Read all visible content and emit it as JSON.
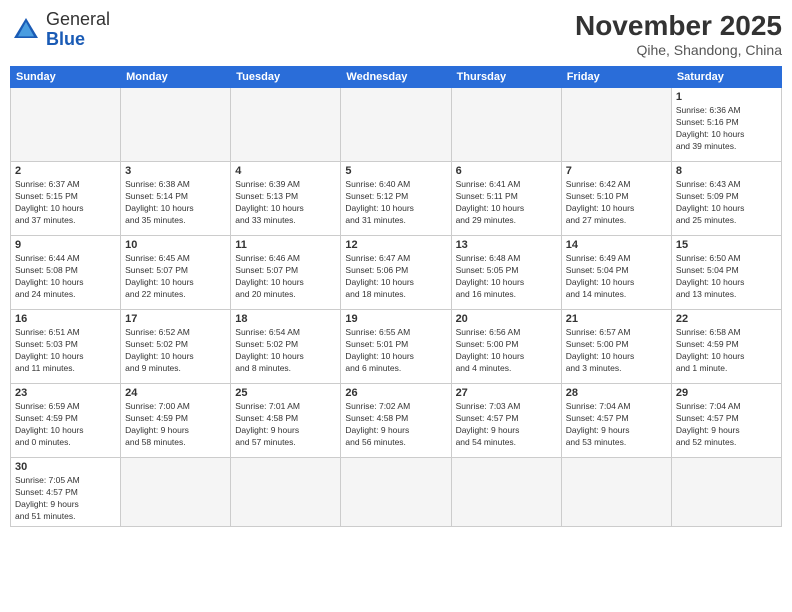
{
  "header": {
    "logo_general": "General",
    "logo_blue": "Blue",
    "month_title": "November 2025",
    "location": "Qihe, Shandong, China"
  },
  "weekdays": [
    "Sunday",
    "Monday",
    "Tuesday",
    "Wednesday",
    "Thursday",
    "Friday",
    "Saturday"
  ],
  "days": {
    "d1": {
      "num": "1",
      "info": "Sunrise: 6:36 AM\nSunset: 5:16 PM\nDaylight: 10 hours\nand 39 minutes."
    },
    "d2": {
      "num": "2",
      "info": "Sunrise: 6:37 AM\nSunset: 5:15 PM\nDaylight: 10 hours\nand 37 minutes."
    },
    "d3": {
      "num": "3",
      "info": "Sunrise: 6:38 AM\nSunset: 5:14 PM\nDaylight: 10 hours\nand 35 minutes."
    },
    "d4": {
      "num": "4",
      "info": "Sunrise: 6:39 AM\nSunset: 5:13 PM\nDaylight: 10 hours\nand 33 minutes."
    },
    "d5": {
      "num": "5",
      "info": "Sunrise: 6:40 AM\nSunset: 5:12 PM\nDaylight: 10 hours\nand 31 minutes."
    },
    "d6": {
      "num": "6",
      "info": "Sunrise: 6:41 AM\nSunset: 5:11 PM\nDaylight: 10 hours\nand 29 minutes."
    },
    "d7": {
      "num": "7",
      "info": "Sunrise: 6:42 AM\nSunset: 5:10 PM\nDaylight: 10 hours\nand 27 minutes."
    },
    "d8": {
      "num": "8",
      "info": "Sunrise: 6:43 AM\nSunset: 5:09 PM\nDaylight: 10 hours\nand 25 minutes."
    },
    "d9": {
      "num": "9",
      "info": "Sunrise: 6:44 AM\nSunset: 5:08 PM\nDaylight: 10 hours\nand 24 minutes."
    },
    "d10": {
      "num": "10",
      "info": "Sunrise: 6:45 AM\nSunset: 5:07 PM\nDaylight: 10 hours\nand 22 minutes."
    },
    "d11": {
      "num": "11",
      "info": "Sunrise: 6:46 AM\nSunset: 5:07 PM\nDaylight: 10 hours\nand 20 minutes."
    },
    "d12": {
      "num": "12",
      "info": "Sunrise: 6:47 AM\nSunset: 5:06 PM\nDaylight: 10 hours\nand 18 minutes."
    },
    "d13": {
      "num": "13",
      "info": "Sunrise: 6:48 AM\nSunset: 5:05 PM\nDaylight: 10 hours\nand 16 minutes."
    },
    "d14": {
      "num": "14",
      "info": "Sunrise: 6:49 AM\nSunset: 5:04 PM\nDaylight: 10 hours\nand 14 minutes."
    },
    "d15": {
      "num": "15",
      "info": "Sunrise: 6:50 AM\nSunset: 5:04 PM\nDaylight: 10 hours\nand 13 minutes."
    },
    "d16": {
      "num": "16",
      "info": "Sunrise: 6:51 AM\nSunset: 5:03 PM\nDaylight: 10 hours\nand 11 minutes."
    },
    "d17": {
      "num": "17",
      "info": "Sunrise: 6:52 AM\nSunset: 5:02 PM\nDaylight: 10 hours\nand 9 minutes."
    },
    "d18": {
      "num": "18",
      "info": "Sunrise: 6:54 AM\nSunset: 5:02 PM\nDaylight: 10 hours\nand 8 minutes."
    },
    "d19": {
      "num": "19",
      "info": "Sunrise: 6:55 AM\nSunset: 5:01 PM\nDaylight: 10 hours\nand 6 minutes."
    },
    "d20": {
      "num": "20",
      "info": "Sunrise: 6:56 AM\nSunset: 5:00 PM\nDaylight: 10 hours\nand 4 minutes."
    },
    "d21": {
      "num": "21",
      "info": "Sunrise: 6:57 AM\nSunset: 5:00 PM\nDaylight: 10 hours\nand 3 minutes."
    },
    "d22": {
      "num": "22",
      "info": "Sunrise: 6:58 AM\nSunset: 4:59 PM\nDaylight: 10 hours\nand 1 minute."
    },
    "d23": {
      "num": "23",
      "info": "Sunrise: 6:59 AM\nSunset: 4:59 PM\nDaylight: 10 hours\nand 0 minutes."
    },
    "d24": {
      "num": "24",
      "info": "Sunrise: 7:00 AM\nSunset: 4:59 PM\nDaylight: 9 hours\nand 58 minutes."
    },
    "d25": {
      "num": "25",
      "info": "Sunrise: 7:01 AM\nSunset: 4:58 PM\nDaylight: 9 hours\nand 57 minutes."
    },
    "d26": {
      "num": "26",
      "info": "Sunrise: 7:02 AM\nSunset: 4:58 PM\nDaylight: 9 hours\nand 56 minutes."
    },
    "d27": {
      "num": "27",
      "info": "Sunrise: 7:03 AM\nSunset: 4:57 PM\nDaylight: 9 hours\nand 54 minutes."
    },
    "d28": {
      "num": "28",
      "info": "Sunrise: 7:04 AM\nSunset: 4:57 PM\nDaylight: 9 hours\nand 53 minutes."
    },
    "d29": {
      "num": "29",
      "info": "Sunrise: 7:04 AM\nSunset: 4:57 PM\nDaylight: 9 hours\nand 52 minutes."
    },
    "d30": {
      "num": "30",
      "info": "Sunrise: 7:05 AM\nSunset: 4:57 PM\nDaylight: 9 hours\nand 51 minutes."
    }
  }
}
